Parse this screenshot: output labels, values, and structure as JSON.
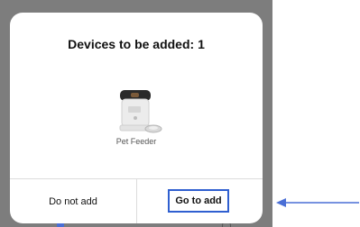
{
  "dialog": {
    "title": "Devices to be added: 1",
    "device": {
      "label": "Pet Feeder",
      "image_icon": "pet-feeder-icon"
    },
    "buttons": {
      "decline_label": "Do not add",
      "confirm_label": "Go to add"
    }
  },
  "colors": {
    "backdrop": "#7d7d7d",
    "highlight": "#2f5fd0",
    "arrow": "#4a6fd6"
  }
}
